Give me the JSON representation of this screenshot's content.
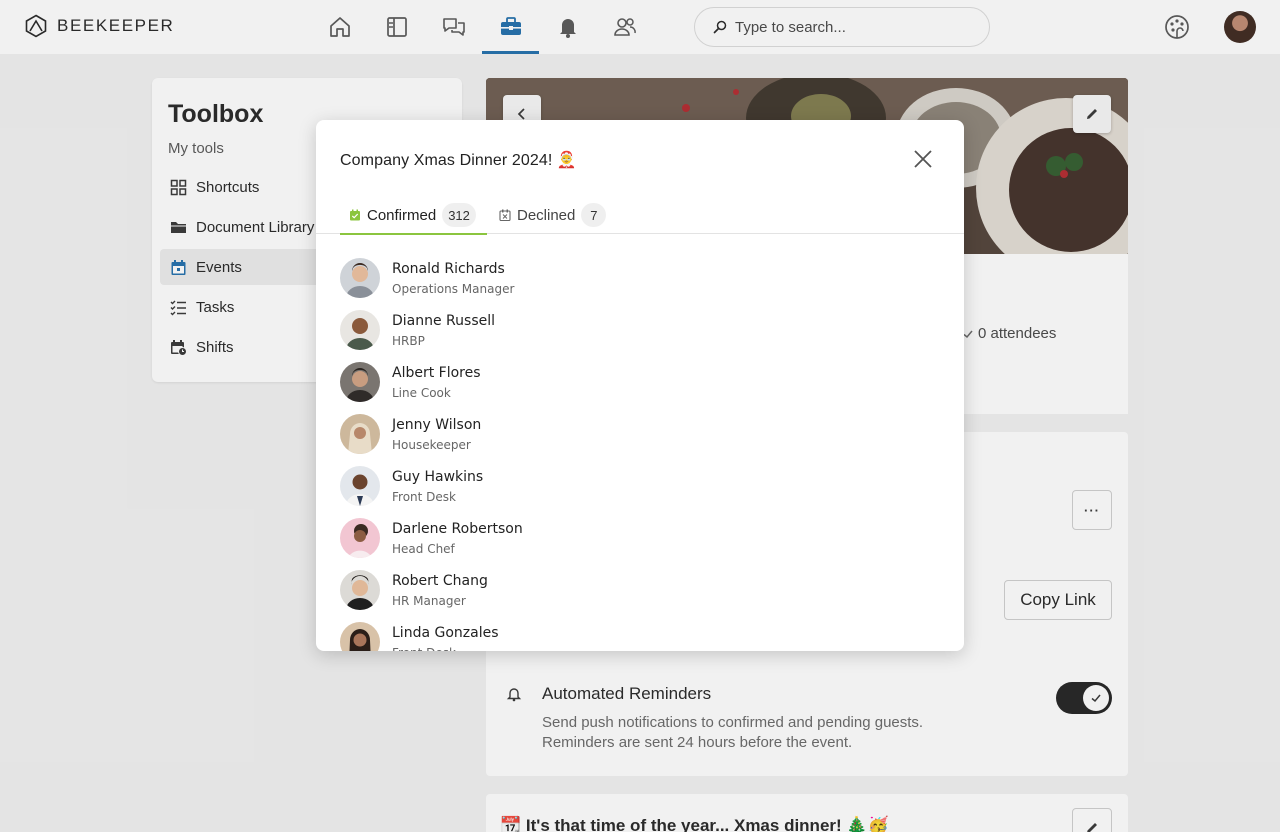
{
  "app": {
    "logo_text": "BEEKEEPER"
  },
  "search": {
    "placeholder": "Type to search..."
  },
  "toolbox": {
    "title": "Toolbox",
    "subtitle": "My tools",
    "items": [
      {
        "label": "Shortcuts",
        "icon": "grid-icon"
      },
      {
        "label": "Document Library",
        "icon": "folder-icon"
      },
      {
        "label": "Events",
        "icon": "calendar-icon",
        "active": true
      },
      {
        "label": "Tasks",
        "icon": "checklist-icon"
      },
      {
        "label": "Shifts",
        "icon": "calendar-clock-icon"
      }
    ]
  },
  "event": {
    "attendees": "0 attendees",
    "copy_link": "Copy Link",
    "more": "···",
    "reminders": {
      "title": "Automated Reminders",
      "desc": "Send push notifications to confirmed and pending guests. Reminders are sent 24 hours before the event.",
      "enabled": true
    },
    "post_title": "📆 It's that time of the year... Xmas dinner! 🎄🥳"
  },
  "modal": {
    "title": "Company Xmas Dinner 2024! 🤶",
    "tabs": [
      {
        "label": "Confirmed",
        "count": "312",
        "active": true
      },
      {
        "label": "Declined",
        "count": "7",
        "active": false
      }
    ],
    "people": [
      {
        "name": "Ronald Richards",
        "role": "Operations Manager"
      },
      {
        "name": "Dianne Russell",
        "role": "HRBP"
      },
      {
        "name": "Albert Flores",
        "role": "Line Cook"
      },
      {
        "name": "Jenny Wilson",
        "role": "Housekeeper"
      },
      {
        "name": "Guy Hawkins",
        "role": "Front Desk"
      },
      {
        "name": "Darlene Robertson",
        "role": "Head Chef"
      },
      {
        "name": "Robert Chang",
        "role": "HR Manager"
      },
      {
        "name": "Linda Gonzales",
        "role": "Front Desk"
      }
    ]
  },
  "colors": {
    "accent": "#1e6dab",
    "tab_active": "#8bc53f",
    "confirmed_icon": "#8bc53f"
  }
}
